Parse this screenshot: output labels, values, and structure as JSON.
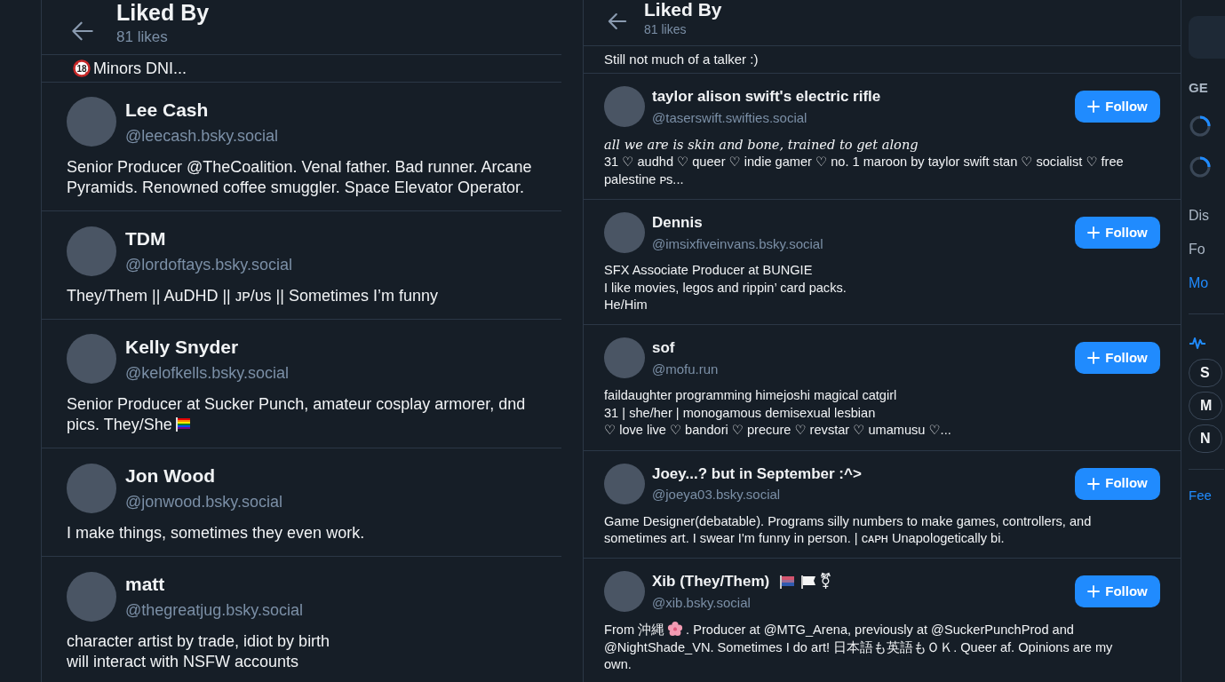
{
  "left_panel": {
    "title": "Liked By",
    "subtitle": "81 likes",
    "partial_row": [
      {
        "kind": "no-minors",
        "text": "18"
      },
      {
        "kind": "text",
        "text": "Minors DNI..."
      }
    ],
    "users": [
      {
        "name": "Lee Cash",
        "handle": "@leecash.bsky.social",
        "bio": [
          [
            {
              "kind": "text",
              "text": "Senior Producer @TheCoalition. Venal father. Bad runner. Arcane Pyramids. Renowned coffee smuggler. Space Elevator Operator."
            }
          ]
        ]
      },
      {
        "name": "TDM",
        "handle": "@lordoftays.bsky.social",
        "bio": [
          [
            {
              "kind": "text",
              "text": "They/Them || AuDHD || ᴊᴘ/ᴜs || Sometimes I’m funny"
            }
          ]
        ]
      },
      {
        "name": "Kelly Snyder",
        "handle": "@kelofkells.bsky.social",
        "bio": [
          [
            {
              "kind": "text",
              "text": "Senior Producer at Sucker Punch, amateur cosplay armorer, dnd"
            }
          ],
          [
            {
              "kind": "text",
              "text": "pics. They/She"
            },
            {
              "kind": "rainbow-flag"
            }
          ]
        ]
      },
      {
        "name": "Jon Wood",
        "handle": "@jonwood.bsky.social",
        "bio": [
          [
            {
              "kind": "text",
              "text": "I make things, sometimes they even work."
            }
          ]
        ]
      },
      {
        "name": "matt",
        "handle": "@thegreatjug.bsky.social",
        "bio": [
          [
            {
              "kind": "text",
              "text": "character artist by trade, idiot by birth"
            }
          ],
          [
            {
              "kind": "text",
              "text": "will interact with NSFW accounts"
            }
          ]
        ]
      }
    ]
  },
  "right_panel": {
    "title": "Liked By",
    "subtitle": "81 likes",
    "partial_row": [
      {
        "kind": "text",
        "text": "Still not much of a talker :)"
      }
    ],
    "users": [
      {
        "name": "taylor alison swift's electric rifle",
        "handle": "@taserswift.swifties.social",
        "follow_button": "Follow",
        "bio": [
          [
            {
              "kind": "italic",
              "text": "all we are is skin and bone, trained to get along"
            }
          ],
          [
            {
              "kind": "text",
              "text": "31 ♡ audhd ♡ queer ♡ indie gamer ♡ no. 1 maroon by taylor swift stan ♡ socialist ♡ free palestine ᴘs..."
            }
          ]
        ]
      },
      {
        "name": "Dennis",
        "handle": "@imsixfiveinvans.bsky.social",
        "follow_button": "Follow",
        "bio": [
          [
            {
              "kind": "text",
              "text": "SFX Associate Producer at BUNGIE"
            }
          ],
          [
            {
              "kind": "text",
              "text": "I like movies, legos and rippin’ card packs."
            }
          ],
          [
            {
              "kind": "text",
              "text": "He/Him"
            }
          ]
        ]
      },
      {
        "name": "sof",
        "handle": "@mofu.run",
        "follow_button": "Follow",
        "bio": [
          [
            {
              "kind": "text",
              "text": "faildaughter programming himejoshi magical catgirl"
            }
          ],
          [
            {
              "kind": "text",
              "text": "31 | she/her | monogamous demisexual lesbian"
            }
          ],
          [
            {
              "kind": "text",
              "text": "♡ love live ♡ bandori ♡ precure ♡ revstar ♡ umamusu ♡..."
            }
          ]
        ]
      },
      {
        "name": "Joey...? but in September :^>",
        "handle": "@joeya03.bsky.social",
        "follow_button": "Follow",
        "bio": [
          [
            {
              "kind": "text",
              "text": "Game Designer(debatable). Programs silly numbers to make games, controllers, and sometimes art. I swear I'm funny in person. | ᴄᴀᴘʜ Unapologetically bi."
            }
          ]
        ]
      },
      {
        "name": "Xib (They/Them)",
        "name_extra": [
          {
            "kind": "striped-flag"
          },
          {
            "kind": "white-flag"
          },
          {
            "kind": "text",
            "text": "⚧"
          }
        ],
        "handle": "@xib.bsky.social",
        "follow_button": "Follow",
        "bio": [
          [
            {
              "kind": "text",
              "text": "From 沖縄"
            },
            {
              "kind": "flower"
            },
            {
              "kind": "text",
              "text": ". Producer at @MTG_Arena, previously at @SuckerPunchProd and"
            }
          ],
          [
            {
              "kind": "text",
              "text": "@NightShade_VN. Sometimes I do art! 日本語も英語もＯＫ. Queer af. Opinions are my"
            }
          ],
          [
            {
              "kind": "text",
              "text": "own."
            }
          ]
        ]
      }
    ]
  },
  "sidebar": {
    "section_label": "GE",
    "links": [
      {
        "text": "Dis",
        "kind": "plain"
      },
      {
        "text": "Fo",
        "kind": "plain"
      },
      {
        "text": "Mo",
        "kind": "link"
      }
    ],
    "pills": [
      "S",
      "M",
      "N"
    ],
    "footer_link": "Fee"
  }
}
